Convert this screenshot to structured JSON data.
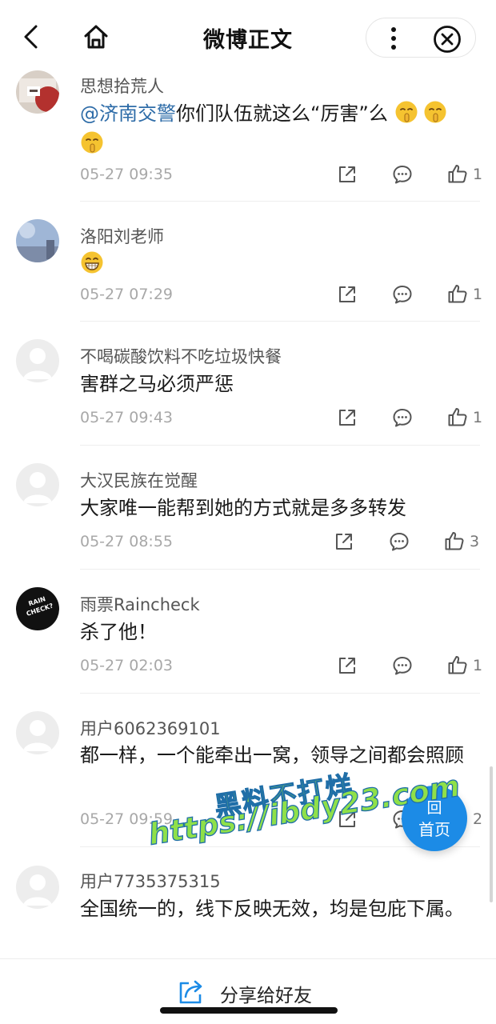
{
  "header": {
    "title": "微博正文"
  },
  "comments": [
    {
      "username": "思想拾荒人",
      "mention": "@济南交警",
      "text": "你们队伍就这么“厉害”么",
      "time": "05-27 09:35",
      "likes": "1"
    },
    {
      "username": "洛阳刘老师",
      "text": "",
      "time": "05-27 07:29",
      "likes": "1"
    },
    {
      "username": "不喝碳酸饮料不吃垃圾快餐",
      "text": "害群之马必须严惩",
      "time": "05-27 09:43",
      "likes": "1"
    },
    {
      "username": "大汉民族在觉醒",
      "text": "大家唯一能帮到她的方式就是多多转发",
      "time": "05-27 08:55",
      "likes": "3"
    },
    {
      "username": "雨票Raincheck",
      "text": "杀了他！",
      "time": "05-27 02:03",
      "likes": "1",
      "avatar_text": "RAIN CHECK?"
    },
    {
      "username": "用户6062369101",
      "text": "都一样，一个能牵出一窝，领导之间都会照顾",
      "time": "05-27 09:59",
      "likes": "2"
    },
    {
      "username": "用户7735375315",
      "text": "全国统一的，线下反映无效，均是包庇下属。"
    }
  ],
  "fab": {
    "line1": "回",
    "line2": "首页"
  },
  "watermark": {
    "line1": "黑料不打烊",
    "line2": "https://ibdy23.com"
  },
  "bottom": {
    "share_label": "分享给好友"
  },
  "colors": {
    "accent": "#1c8be6",
    "mention": "#2e6ca8",
    "watermark_fill": "#8fe049"
  },
  "icons": {
    "back": "chevron-left-icon",
    "home": "home-icon",
    "more": "more-vertical-icon",
    "close": "close-circle-icon",
    "repost": "repost-icon",
    "comment": "comment-icon",
    "like": "thumbs-up-icon",
    "share": "share-icon"
  }
}
